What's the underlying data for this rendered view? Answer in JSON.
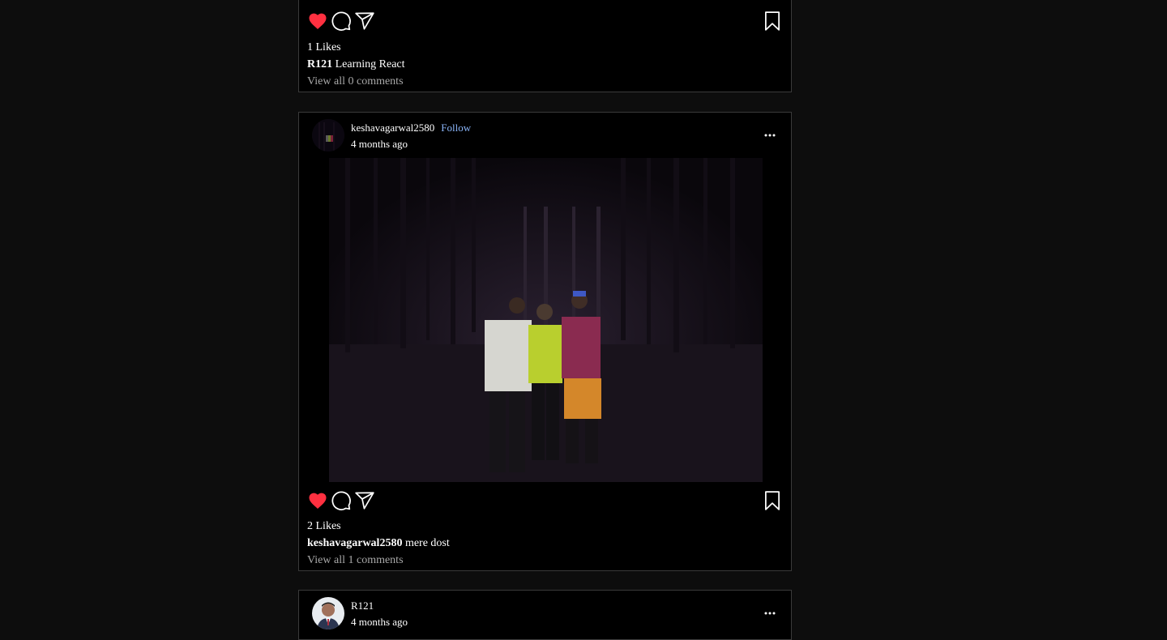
{
  "posts": [
    {
      "likes": "1 Likes",
      "author": "R121",
      "caption": "Learning React",
      "comments": "View all 0 comments",
      "liked": true
    },
    {
      "username": "keshavagarwal2580",
      "follow_label": "Follow",
      "timestamp": "4 months ago",
      "likes": "2 Likes",
      "author": "keshavagarwal2580",
      "caption": "mere dost",
      "comments": "View all 1 comments",
      "liked": true
    },
    {
      "username": "R121",
      "timestamp": "4 months ago"
    }
  ],
  "icons": {
    "like": "heart-icon",
    "comment": "comment-icon",
    "share": "send-icon",
    "save": "bookmark-icon",
    "more": "more-icon"
  },
  "colors": {
    "like_active": "#ff3040",
    "follow_link": "#8ab4f8",
    "background": "#0d0d0d",
    "card": "#000000"
  }
}
